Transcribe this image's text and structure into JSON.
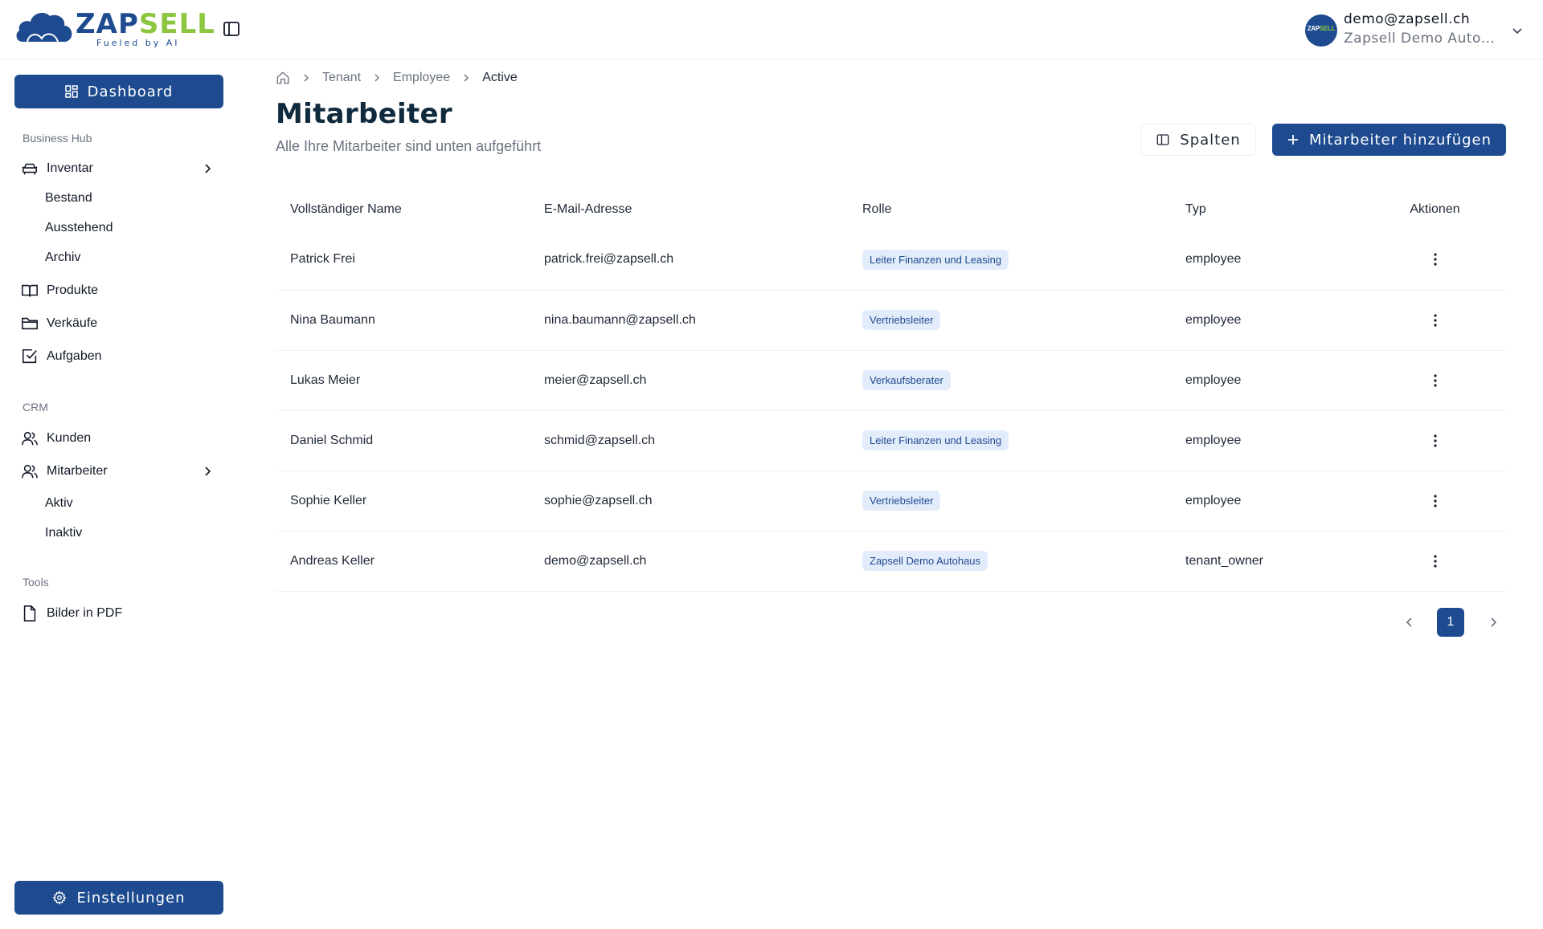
{
  "header": {
    "logo_zap": "ZAP",
    "logo_sell": "SELL",
    "logo_tagline": "Fueled by AI",
    "account_email": "demo@zapsell.ch",
    "account_org": "Zapsell Demo Autohaus",
    "avatar_text_a": "ZAP",
    "avatar_text_b": "SELL"
  },
  "sidebar": {
    "dashboard_label": "Dashboard",
    "sections": {
      "business_hub": "Business Hub",
      "crm": "CRM",
      "tools": "Tools"
    },
    "items": {
      "inventar": "Inventar",
      "bestand": "Bestand",
      "ausstehend": "Ausstehend",
      "archiv": "Archiv",
      "produkte": "Produkte",
      "verkaeufe": "Verkäufe",
      "aufgaben": "Aufgaben",
      "kunden": "Kunden",
      "mitarbeiter": "Mitarbeiter",
      "aktiv": "Aktiv",
      "inaktiv": "Inaktiv",
      "bilder_pdf": "Bilder in PDF"
    },
    "settings_label": "Einstellungen"
  },
  "breadcrumb": [
    "Tenant",
    "Employee",
    "Active"
  ],
  "page": {
    "title": "Mitarbeiter",
    "subtitle": "Alle Ihre Mitarbeiter sind unten aufgeführt",
    "columns_button": "Spalten",
    "add_button": "Mitarbeiter hinzufügen"
  },
  "table": {
    "headers": [
      "Vollständiger Name",
      "E-Mail-Adresse",
      "Rolle",
      "Typ",
      "Aktionen"
    ],
    "rows": [
      {
        "name": "Patrick Frei",
        "email": "patrick.frei@zapsell.ch",
        "role": "Leiter Finanzen und Leasing",
        "type": "employee"
      },
      {
        "name": "Nina Baumann",
        "email": "nina.baumann@zapsell.ch",
        "role": "Vertriebsleiter",
        "type": "employee"
      },
      {
        "name": "Lukas Meier",
        "email": "meier@zapsell.ch",
        "role": "Verkaufsberater",
        "type": "employee"
      },
      {
        "name": "Daniel Schmid",
        "email": "schmid@zapsell.ch",
        "role": "Leiter Finanzen und Leasing",
        "type": "employee"
      },
      {
        "name": "Sophie Keller",
        "email": "sophie@zapsell.ch",
        "role": "Vertriebsleiter",
        "type": "employee"
      },
      {
        "name": "Andreas Keller",
        "email": "demo@zapsell.ch",
        "role": "Zapsell Demo Autohaus",
        "type": "tenant_owner"
      }
    ]
  },
  "pagination": {
    "current_page": "1"
  },
  "colors": {
    "primary": "#1e4b8f",
    "accent": "#8cc63f",
    "badge_bg": "#e3ecfb"
  }
}
